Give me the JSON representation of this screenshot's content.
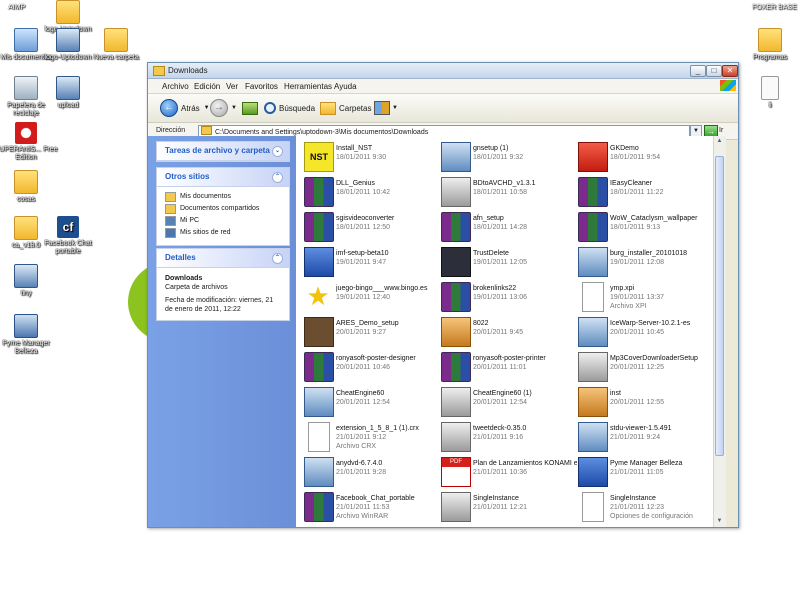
{
  "desktop": {
    "top_left_label": "AIMP",
    "top_right_label": "FOXER BASE",
    "icons": [
      {
        "name": "desktop-icon-logo-uptodown",
        "label": "logo-Uptodown",
        "glyph": "folder"
      },
      {
        "name": "desktop-icon-mis-documentos",
        "label": "Mis documentos",
        "glyph": "docs"
      },
      {
        "name": "desktop-icon-logo-uptodown-2",
        "label": "logo-Uptodown",
        "glyph": "setup"
      },
      {
        "name": "desktop-icon-nueva-carpeta",
        "label": "Nueva carpeta",
        "glyph": "folder"
      },
      {
        "name": "desktop-icon-papelera",
        "label": "Papelera de reciclaje",
        "glyph": "bin"
      },
      {
        "name": "desktop-icon-upload",
        "label": "upload",
        "glyph": "pc"
      },
      {
        "name": "desktop-icon-superantispyware",
        "label": "SUPERAntiS... Free Edition",
        "glyph": "red"
      },
      {
        "name": "desktop-icon-cosas",
        "label": "cosas",
        "glyph": "folder"
      },
      {
        "name": "desktop-icon-ca-v18",
        "label": "ca_v18.0",
        "glyph": "folder"
      },
      {
        "name": "desktop-icon-facebook-chat",
        "label": "Facebook Chat portable",
        "glyph": "cf"
      },
      {
        "name": "desktop-icon-my",
        "label": "tiny",
        "glyph": "pc"
      },
      {
        "name": "desktop-icon-pyme",
        "label": "Pyme Manager Belleza",
        "glyph": "net"
      },
      {
        "name": "desktop-icon-programs",
        "label": "Programas",
        "glyph": "folder"
      },
      {
        "name": "desktop-icon-file",
        "label": "ii",
        "glyph": "file"
      }
    ]
  },
  "window": {
    "title": "Downloads",
    "buttons": {
      "minimize": "_",
      "maximize": "□",
      "close": "✕"
    },
    "menu": [
      "Archivo",
      "Edición",
      "Ver",
      "Favoritos",
      "Herramientas",
      "Ayuda"
    ],
    "toolbar": {
      "back": "Atrás",
      "search": "Búsqueda",
      "folders": "Carpetas"
    },
    "address": {
      "label": "Dirección",
      "value": "C:\\Documents and Settings\\uptodown-3\\Mis documentos\\Downloads",
      "go": "Ir"
    }
  },
  "sidebar": {
    "tasks": {
      "title": "Tareas de archivo y carpeta"
    },
    "other": {
      "title": "Otros sitios",
      "items": [
        "Mis documentos",
        "Documentos compartidos",
        "Mi PC",
        "Mis sitios de red"
      ]
    },
    "details": {
      "title": "Detalles",
      "name": "Downloads",
      "type": "Carpeta de archivos",
      "modified": "Fecha de modificación: viernes, 21 de enero de 2011, 12:22"
    }
  },
  "files": [
    {
      "name": "Install_NST",
      "sub": "18/01/2011 9:30",
      "icon": "nst"
    },
    {
      "name": "gnsetup (1)",
      "sub": "18/01/2011 9:32",
      "icon": "setup"
    },
    {
      "name": "GKDemo",
      "sub": "18/01/2011 9:54",
      "icon": "red"
    },
    {
      "name": "DLL_Genius",
      "sub": "18/01/2011 10:42",
      "icon": "winrar"
    },
    {
      "name": "BDtoAVCHD_v1.3.1",
      "sub": "18/01/2011 10:58",
      "icon": "app"
    },
    {
      "name": "IEasyCleaner",
      "sub": "18/01/2011 11:22",
      "icon": "winrar"
    },
    {
      "name": "sgisvideoconverter",
      "sub": "18/01/2011 12:50",
      "icon": "winrar"
    },
    {
      "name": "afn_setup",
      "sub": "18/01/2011 14:28",
      "icon": "winrar"
    },
    {
      "name": "WoW_Cataclysm_wallpaper",
      "sub": "18/01/2011 9:13",
      "icon": "winrar"
    },
    {
      "name": "imf-setup-beta10",
      "sub": "19/01/2011 9:47",
      "icon": "blue"
    },
    {
      "name": "TrustDelete",
      "sub": "19/01/2011 12:05",
      "icon": "dark"
    },
    {
      "name": "burg_installer_20101018",
      "sub": "19/01/2011 12:08",
      "icon": "setup"
    },
    {
      "name": "juego-bingo___www.bingo.es",
      "sub": "19/01/2011 12:40",
      "icon": "star"
    },
    {
      "name": "brokenlinks22",
      "sub": "19/01/2011 13:06",
      "icon": "winrar"
    },
    {
      "name": "ymp.xpi",
      "sub": "19/01/2011 13:37",
      "sub2": "Archivo XPI",
      "icon": "doc"
    },
    {
      "name": "ARES_Demo_setup",
      "sub": "20/01/2011 9:27",
      "icon": "choc"
    },
    {
      "name": "8022",
      "sub": "20/01/2011 9:45",
      "icon": "orange"
    },
    {
      "name": "IceWarp-Server-10.2.1-es",
      "sub": "20/01/2011 10:45",
      "icon": "setup"
    },
    {
      "name": "ronyasoft-poster-designer",
      "sub": "20/01/2011 10:46",
      "icon": "winrar"
    },
    {
      "name": "ronyasoft-poster-printer",
      "sub": "20/01/2011 11:01",
      "icon": "winrar"
    },
    {
      "name": "Mp3CoverDownloaderSetup",
      "sub": "20/01/2011 12:25",
      "icon": "app"
    },
    {
      "name": "CheatEngine60",
      "sub": "20/01/2011 12:54",
      "icon": "setup"
    },
    {
      "name": "CheatEngine60 (1)",
      "sub": "20/01/2011 12:54",
      "icon": "app"
    },
    {
      "name": "inst",
      "sub": "20/01/2011 12:55",
      "icon": "orange"
    },
    {
      "name": "extension_1_5_8_1 (1).crx",
      "sub": "21/01/2011 9:12",
      "sub2": "Archivo CRX",
      "icon": "doc"
    },
    {
      "name": "tweetdeck-0.35.0",
      "sub": "21/01/2011 9:16",
      "icon": "app"
    },
    {
      "name": "stdu-viewer-1.5.491",
      "sub": "21/01/2011 9:24",
      "icon": "setup"
    },
    {
      "name": "anydvd-6.7.4.0",
      "sub": "21/01/2011 9:28",
      "icon": "setup"
    },
    {
      "name": "Plan de Lanzamientos KONAMI enero 2011 Prensa",
      "sub": "21/01/2011 10:36",
      "icon": "pdf"
    },
    {
      "name": "Pyme Manager Belleza",
      "sub": "21/01/2011 11:05",
      "icon": "blue"
    },
    {
      "name": "Facebook_Chat_portable",
      "sub": "21/01/2011 11:53",
      "sub2": "Archivo WinRAR",
      "icon": "winrar"
    },
    {
      "name": "SingleInstance",
      "sub": "21/01/2011 12:21",
      "icon": "app"
    },
    {
      "name": "SingleInstance",
      "sub": "21/01/2011 12:23",
      "sub2": "Opciones de configuración",
      "icon": "doc"
    }
  ]
}
